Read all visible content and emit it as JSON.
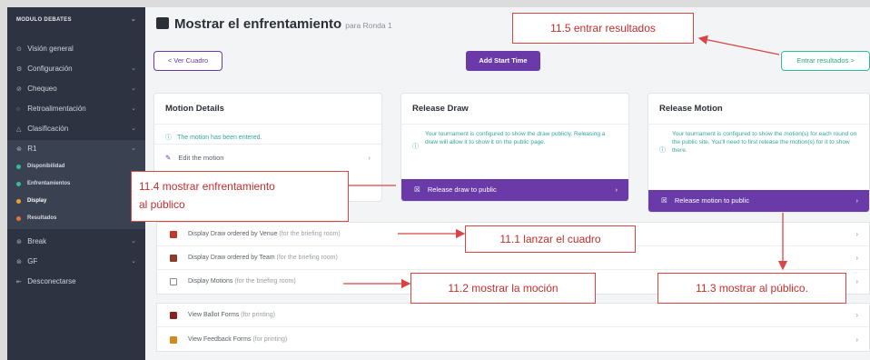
{
  "sidebar": {
    "brand": "MODULO DEBATES",
    "items": [
      {
        "icon": "⊙",
        "label": "Visión general"
      },
      {
        "icon": "⚙",
        "label": "Configuración"
      },
      {
        "icon": "⊘",
        "label": "Chequeo"
      },
      {
        "icon": "○",
        "label": "Retroalimentación"
      },
      {
        "icon": "△",
        "label": "Clasificación"
      }
    ],
    "group_label": "R1",
    "sub_items": [
      {
        "label": "Disponibilidad",
        "color": "#2fbf9a"
      },
      {
        "label": "Enfrentamientos",
        "color": "#2fbf9a"
      },
      {
        "label": "Display",
        "color": "#e8a13a"
      },
      {
        "label": "Resultados",
        "color": "#e8733a"
      }
    ],
    "after_items": [
      {
        "icon": "⊛",
        "label": "Break"
      },
      {
        "icon": "⊛",
        "label": "GF"
      },
      {
        "icon": "⇤",
        "label": "Desconectarse"
      }
    ]
  },
  "header": {
    "title": "Mostrar el enfrentamiento",
    "subtitle": "para Ronda 1",
    "back_button": "< Ver Cuadro",
    "add_start_time": "Add Start Time",
    "enter_results": "Entrar resultados >"
  },
  "cards": {
    "motion": {
      "title": "Motion Details",
      "info": "The motion has been entered.",
      "edit": "Edit the motion"
    },
    "release_draw": {
      "title": "Release Draw",
      "info": "Your tournament is configured to show the draw publicly. Releasing a draw will allow it to show it on the public page.",
      "button": "Release draw to public"
    },
    "release_motion": {
      "title": "Release Motion",
      "info": "Your tournament is configured to show the motion(s) for each round on the public site. You'll need to first release the motion(s) for it to show there.",
      "button": "Release motion to public"
    }
  },
  "list_items": [
    {
      "label": "Display Draw ordered by Venue",
      "hint": "(for the briefing room)",
      "color": "#c0392b"
    },
    {
      "label": "Display Draw ordered by Team",
      "hint": "(for the briefing room)",
      "color": "#8e3b2b"
    },
    {
      "label": "Display Motions",
      "hint": "(for the briefing room)",
      "color": "#888888"
    }
  ],
  "list_items_2": [
    {
      "label": "View Ballot Forms",
      "hint": "(for printing)",
      "color": "#8e1f1f"
    },
    {
      "label": "View Feedback Forms",
      "hint": "(for printing)",
      "color": "#d48a1a"
    }
  ],
  "annotations": {
    "a115": "11.5 entrar resultados",
    "a114_line1": "11.4 mostrar enfrentamiento",
    "a114_line2": "al público",
    "a111": "11.1 lanzar el cuadro",
    "a112": "11.2 mostrar la moción",
    "a113": "11.3 mostrar al público."
  },
  "colors": {
    "sidebar_bg": "#2d3340",
    "accent_purple": "#6a3aa8",
    "info_teal": "#2fa7a0",
    "annotation_red": "#d94545"
  },
  "icons": {
    "info": "info-circle-icon",
    "edit": "edit-icon",
    "release": "release-icon",
    "chevron": "chevron-right-icon"
  }
}
